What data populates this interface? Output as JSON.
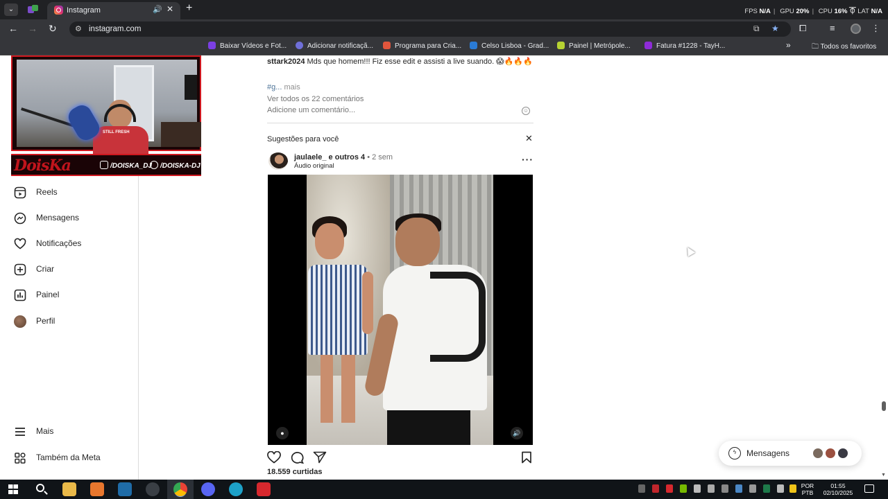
{
  "browser": {
    "tab_title": "Instagram",
    "url": "instagram.com",
    "perf": {
      "fps_label": "FPS",
      "fps_value": "N/A",
      "gpu_label": "GPU",
      "gpu_value": "20%",
      "cpu_label": "CPU",
      "cpu_value": "16%",
      "lat_label": "LAT",
      "lat_value": "N/A"
    },
    "bookmarks": [
      {
        "label": "Baixar Vídeos e Fot...",
        "color": "#7b3fe4"
      },
      {
        "label": "Adicionar notificaçã...",
        "color": "#6f6fd8"
      },
      {
        "label": "Programa para Cria...",
        "color": "#e0553c"
      },
      {
        "label": "Celso Lisboa - Grad...",
        "color": "#2a7bd5"
      },
      {
        "label": "Painel | Metrópole...",
        "color": "#b6d232"
      },
      {
        "label": "Fatura #1228 - TayH...",
        "color": "#8e2bd8"
      }
    ],
    "bookmarks_overflow": "»",
    "all_bookmarks": "Todos os favoritos"
  },
  "stream_overlay": {
    "logo_text": "DoisKa",
    "instagram_handle": "/DOISKA_DJ",
    "twitter_handle": "/DOISKA-DJ",
    "shirt_text": "STILL FRESH"
  },
  "sidebar": {
    "items": [
      {
        "label": "Reels",
        "icon": "reels-icon"
      },
      {
        "label": "Mensagens",
        "icon": "messenger-icon"
      },
      {
        "label": "Notificações",
        "icon": "heart-icon"
      },
      {
        "label": "Criar",
        "icon": "plus-square-icon"
      },
      {
        "label": "Painel",
        "icon": "chart-icon"
      },
      {
        "label": "Perfil",
        "icon": "avatar"
      }
    ],
    "more_label": "Mais",
    "meta_label": "Também da Meta"
  },
  "feed": {
    "caption_user": "sttark2024",
    "caption_text": "Mds que homem!!! Fiz esse edit e assisti a live suando. 😱🔥🔥🔥",
    "hashtag": "#g...",
    "more_label": "mais",
    "view_comments": "Ver todos os 22 comentários",
    "add_comment_placeholder": "Adicione um comentário...",
    "suggestions_title": "Sugestões para você",
    "post": {
      "username": "jaulaele_",
      "coauthors": "e outros 4",
      "time": "2 sem",
      "audio": "Áudio original",
      "likes": "18.559 curtidas"
    }
  },
  "messages_pill": {
    "label": "Mensagens"
  },
  "taskbar": {
    "language": "POR",
    "layout": "PTB",
    "time": "01:55",
    "date": "02/10/2025"
  }
}
